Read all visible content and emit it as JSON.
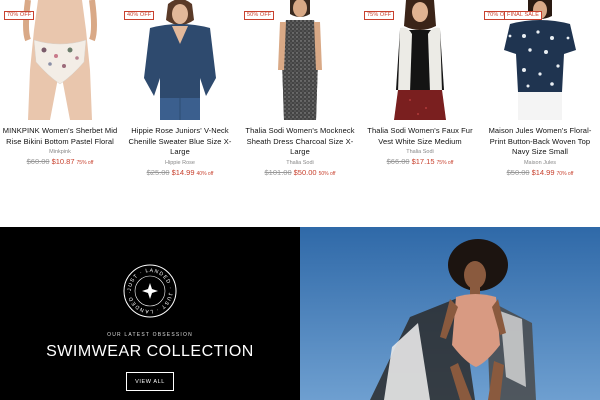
{
  "products": [
    {
      "badges": [
        "70% OFF"
      ],
      "title": "MINKPINK Women's Sherbet Mid Rise Bikini Bottom Pastel Floral",
      "brand": "Minkpink",
      "was_price": "$60.00",
      "sale_price": "$10.87",
      "discount": "75% off"
    },
    {
      "badges": [
        "40% OFF"
      ],
      "title": "Hippie Rose Juniors' V-Neck Chenille Sweater Blue Size X-Large",
      "brand": "Hippie Rose",
      "was_price": "$25.00",
      "sale_price": "$14.99",
      "discount": "40% off"
    },
    {
      "badges": [
        "50% OFF"
      ],
      "title": "Thalia Sodi Women's Mockneck Sheath Dress Charcoal Size X-Large",
      "brand": "Thalia Sodi",
      "was_price": "$101.00",
      "sale_price": "$50.00",
      "discount": "50% off"
    },
    {
      "badges": [
        "75% OFF"
      ],
      "title": "Thalia Sodi Women's Faux Fur Vest White Size Medium",
      "brand": "Thalia Sodi",
      "was_price": "$66.00",
      "sale_price": "$17.15",
      "discount": "75% off"
    },
    {
      "badges": [
        "70% OFF",
        "FINAL SALE"
      ],
      "title": "Maison Jules Women's Floral-Print Button-Back Woven Top Navy Size Small",
      "brand": "Maison Jules",
      "was_price": "$50.00",
      "sale_price": "$14.99",
      "discount": "70% off"
    }
  ],
  "promo": {
    "seal_text": "JUST · LANDED · JUST · LANDED ·",
    "eyebrow": "OUR LATEST OBSESSION",
    "heading": "SWIMWEAR COLLECTION",
    "button_label": "VIEW ALL"
  },
  "colors": {
    "sale_red": "#c8412e",
    "banner_black": "#000000",
    "sky_blue": "#3e78b8"
  }
}
